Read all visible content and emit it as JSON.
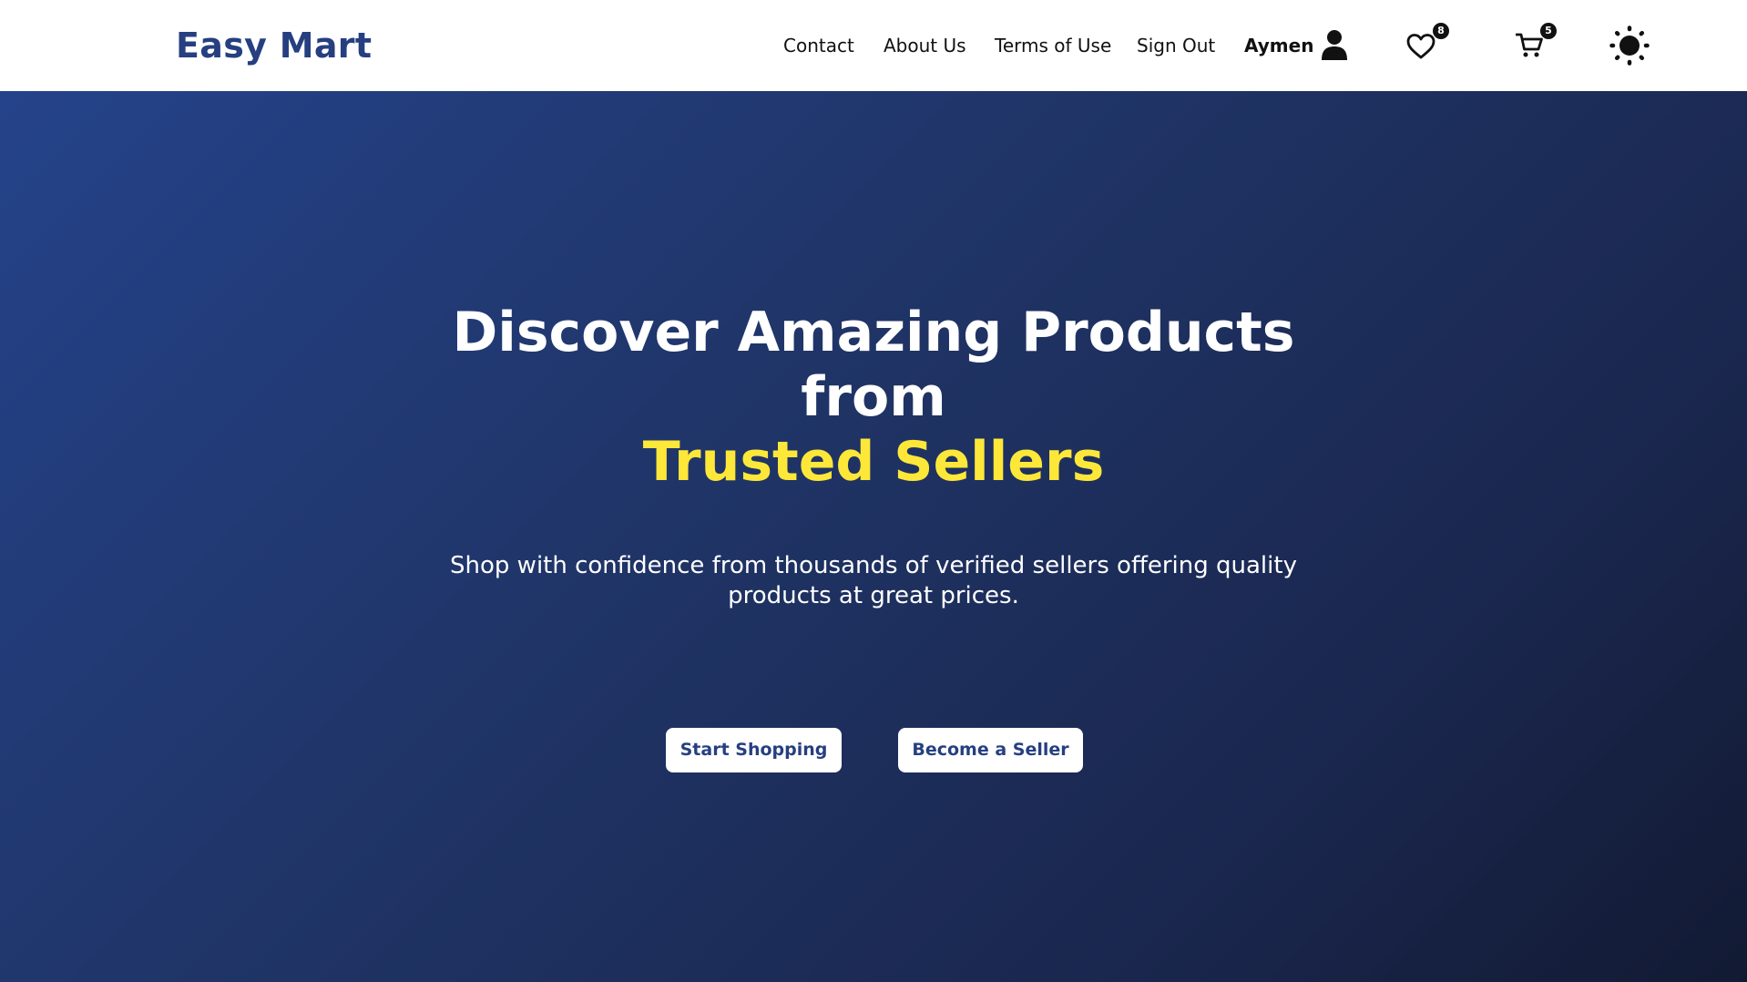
{
  "brand": {
    "name": "Easy Mart",
    "color": "#263f80"
  },
  "nav": {
    "links": [
      "Contact",
      "About Us",
      "Terms of Use",
      "Sign Out"
    ],
    "user_name": "Aymen",
    "icons": {
      "user": "user-icon",
      "wishlist": "heart-icon",
      "cart": "cart-icon",
      "theme": "sun-icon"
    },
    "wishlist_count": "8",
    "cart_count": "5"
  },
  "hero": {
    "title_line1": "Discover Amazing Products",
    "title_line2": "from",
    "title_accent": "Trusted Sellers",
    "subtitle": "Shop with confidence from thousands of verified sellers offering quality products at great prices.",
    "primary_button": "Start Shopping",
    "secondary_button": "Become a Seller",
    "accent_color": "#fde739",
    "gradient_start": "#25438a",
    "gradient_end": "#121a33"
  }
}
